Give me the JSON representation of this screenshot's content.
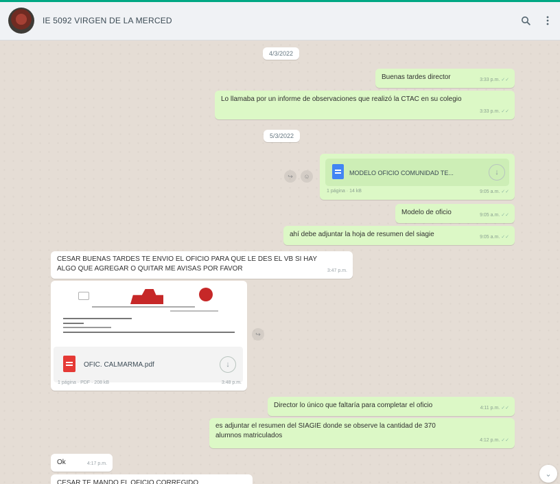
{
  "header": {
    "chat_name": "IE 5092 VIRGEN DE LA MERCED",
    "search_icon": "search-icon",
    "menu_icon": "more-vertical-icon"
  },
  "messages": {
    "date_1": "4/3/2022",
    "m1_text": "Buenas tardes director",
    "m1_time": "3:33 p.m.",
    "m2_text": "Lo llamaba por un informe de observaciones que realizó la CTAC en su colegio",
    "m2_time": "3:33 p.m.",
    "date_2": "5/3/2022",
    "m3_doc_name": "MODELO OFICIO COMUNIDAD TE...",
    "m3_doc_sub": "1 página · 14 kB",
    "m3_time": "9:05 a.m.",
    "m4_text": "Modelo de oficio",
    "m4_time": "9:05 a.m.",
    "m5_text": "ahí debe adjuntar la hoja de resumen del siagie",
    "m5_time": "9:05 a.m.",
    "m6_text_line1": "CESAR BUENAS TARDES TE ENVIO EL OFICIO PARA QUE LE DES EL VB SI HAY",
    "m6_text_line2": "ALGO QUE AGREGAR O QUITAR ME AVISAS POR FAVOR",
    "m6_time": "3:47 p.m.",
    "m7_pdf_name": "OFIC. CALMARMA.pdf",
    "m7_pdf_sub": "1 página · PDF · 208 kB",
    "m7_time": "3:48 p.m.",
    "m8_text": "Director lo único que faltaría para completar el oficio",
    "m8_time": "4:11 p.m.",
    "m9_text_line1": "es adjuntar el resumen del SIAGIE donde se observe la cantidad de 370",
    "m9_text_line2": "alumnos matriculados",
    "m9_time": "4:12 p.m.",
    "m10_text": "Ok",
    "m10_time": "4:17 p.m.",
    "m11_text": "CESAR TE MANDO EL OFICIO CORREGIDO"
  }
}
